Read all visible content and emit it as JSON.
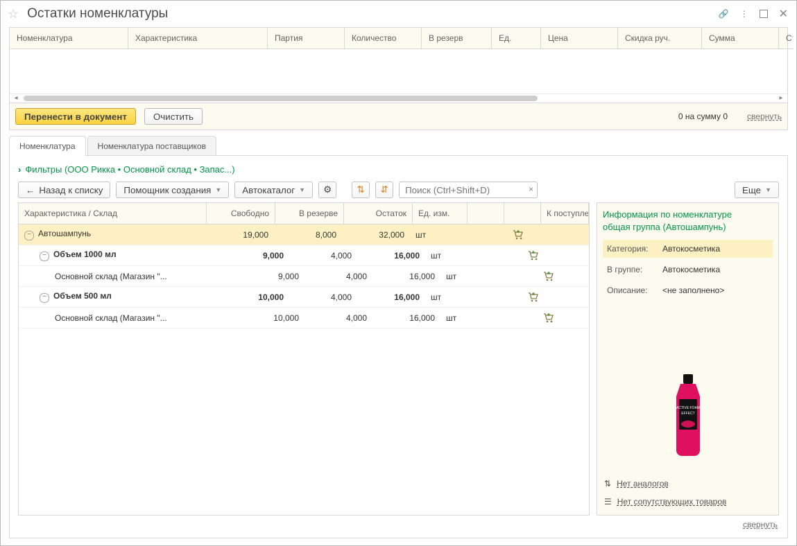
{
  "title": "Остатки номенклатуры",
  "topColumns": [
    "Номенклатура",
    "Характеристика",
    "Партия",
    "Количество",
    "В резерв",
    "Ед.",
    "Цена",
    "Скидка руч.",
    "Сумма",
    "Ставка НДС"
  ],
  "actions": {
    "transfer": "Перенести в документ",
    "clear": "Очистить",
    "summary": "0 на сумму 0",
    "collapse": "свернуть"
  },
  "tabs": {
    "main": "Номенклатура",
    "suppliers": "Номенклатура поставщиков"
  },
  "filtersLabel": "Фильтры (ООО Рикка • Основной склад • Запас...)",
  "toolbar": {
    "back": "Назад к списку",
    "helper": "Помощник создания",
    "catalog": "Автокаталог",
    "more": "Еще",
    "searchPlaceholder": "Поиск (Ctrl+Shift+D)"
  },
  "gridColumns": {
    "name": "Характеристика / Склад",
    "free": "Свободно",
    "reserve": "В резерве",
    "rest": "Остаток",
    "unit": "Ед. изм.",
    "incoming": "К поступлению"
  },
  "rows": [
    {
      "level": 0,
      "toggle": true,
      "selected": true,
      "name": "Автошампунь",
      "free": "19,000",
      "reserve": "8,000",
      "rest": "32,000",
      "unit": "шт"
    },
    {
      "level": 1,
      "toggle": true,
      "bold": true,
      "name": "Объем 1000 мл",
      "free": "9,000",
      "reserve": "4,000",
      "rest": "16,000",
      "unit": "шт"
    },
    {
      "level": 2,
      "name": "Основной склад (Магазин \"...",
      "free": "9,000",
      "reserve": "4,000",
      "rest": "16,000",
      "unit": "шт"
    },
    {
      "level": 1,
      "toggle": true,
      "bold": true,
      "name": "Объем 500 мл",
      "free": "10,000",
      "reserve": "4,000",
      "rest": "16,000",
      "unit": "шт"
    },
    {
      "level": 2,
      "name": "Основной склад (Магазин \"...",
      "free": "10,000",
      "reserve": "4,000",
      "rest": "16,000",
      "unit": "шт"
    }
  ],
  "info": {
    "title1": "Информация по номенклатуре",
    "title2": "общая группа (Автошампунь)",
    "category_label": "Категория:",
    "category": "Автокосметика",
    "group_label": "В группе:",
    "group": "Автокосметика",
    "desc_label": "Описание:",
    "desc": "<не заполнено>",
    "noAnalogs": "Нет аналогов",
    "noRelated": "Нет сопутствующих товаров"
  },
  "footer": {
    "collapse": "свернуть"
  }
}
